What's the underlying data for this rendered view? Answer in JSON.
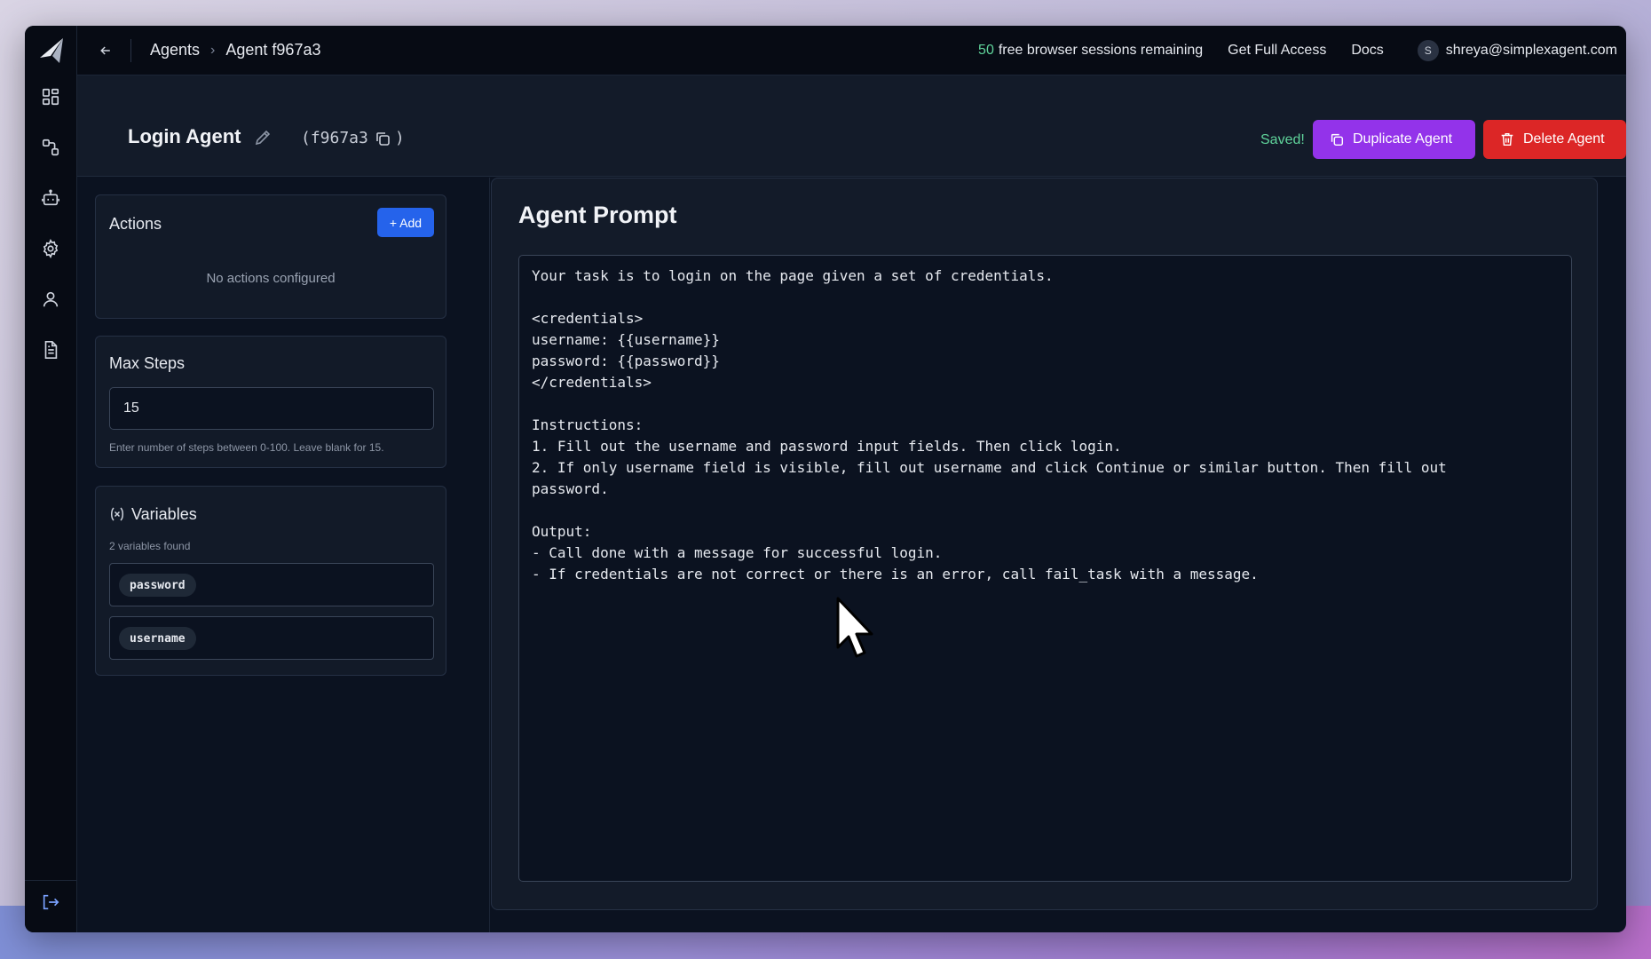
{
  "topbar": {
    "breadcrumb": [
      "Agents",
      "Agent f967a3"
    ],
    "sessions_count": "50",
    "sessions_text": "free browser sessions remaining",
    "get_full_access": "Get Full Access",
    "docs": "Docs",
    "avatar_initial": "S",
    "email": "shreya@simplexagent.com"
  },
  "header": {
    "agent_name": "Login Agent",
    "agent_id_open": "(f967a3",
    "agent_id_close": ")",
    "saved_text": "Saved!",
    "duplicate_label": "Duplicate Agent",
    "delete_label": "Delete Agent"
  },
  "actions": {
    "title": "Actions",
    "add_label": "+ Add",
    "empty_text": "No actions configured"
  },
  "max_steps": {
    "title": "Max Steps",
    "value": "15",
    "help": "Enter number of steps between 0-100. Leave blank for 15."
  },
  "variables": {
    "title": "Variables",
    "count_text": "2 variables found",
    "items": [
      "password",
      "username"
    ]
  },
  "prompt": {
    "title": "Agent Prompt",
    "text": "Your task is to login on the page given a set of credentials.\n\n<credentials>\nusername: {{username}}\npassword: {{password}}\n</credentials>\n\nInstructions:\n1. Fill out the username and password input fields. Then click login.\n2. If only username field is visible, fill out username and click Continue or similar button. Then fill out\npassword.\n\nOutput:\n- Call done with a message for successful login.\n- If credentials are not correct or there is an error, call fail_task with a message."
  },
  "colors": {
    "accent_green": "#5fd39a",
    "duplicate_purple": "#9333ea",
    "delete_red": "#dc2626",
    "add_blue": "#2563eb"
  },
  "icons": [
    "logo-icon",
    "dashboard-icon",
    "workflow-icon",
    "bot-icon",
    "gear-icon",
    "user-icon",
    "document-icon",
    "logout-icon",
    "back-arrow-icon",
    "pencil-icon",
    "copy-icon",
    "trash-icon",
    "variable-icon"
  ]
}
